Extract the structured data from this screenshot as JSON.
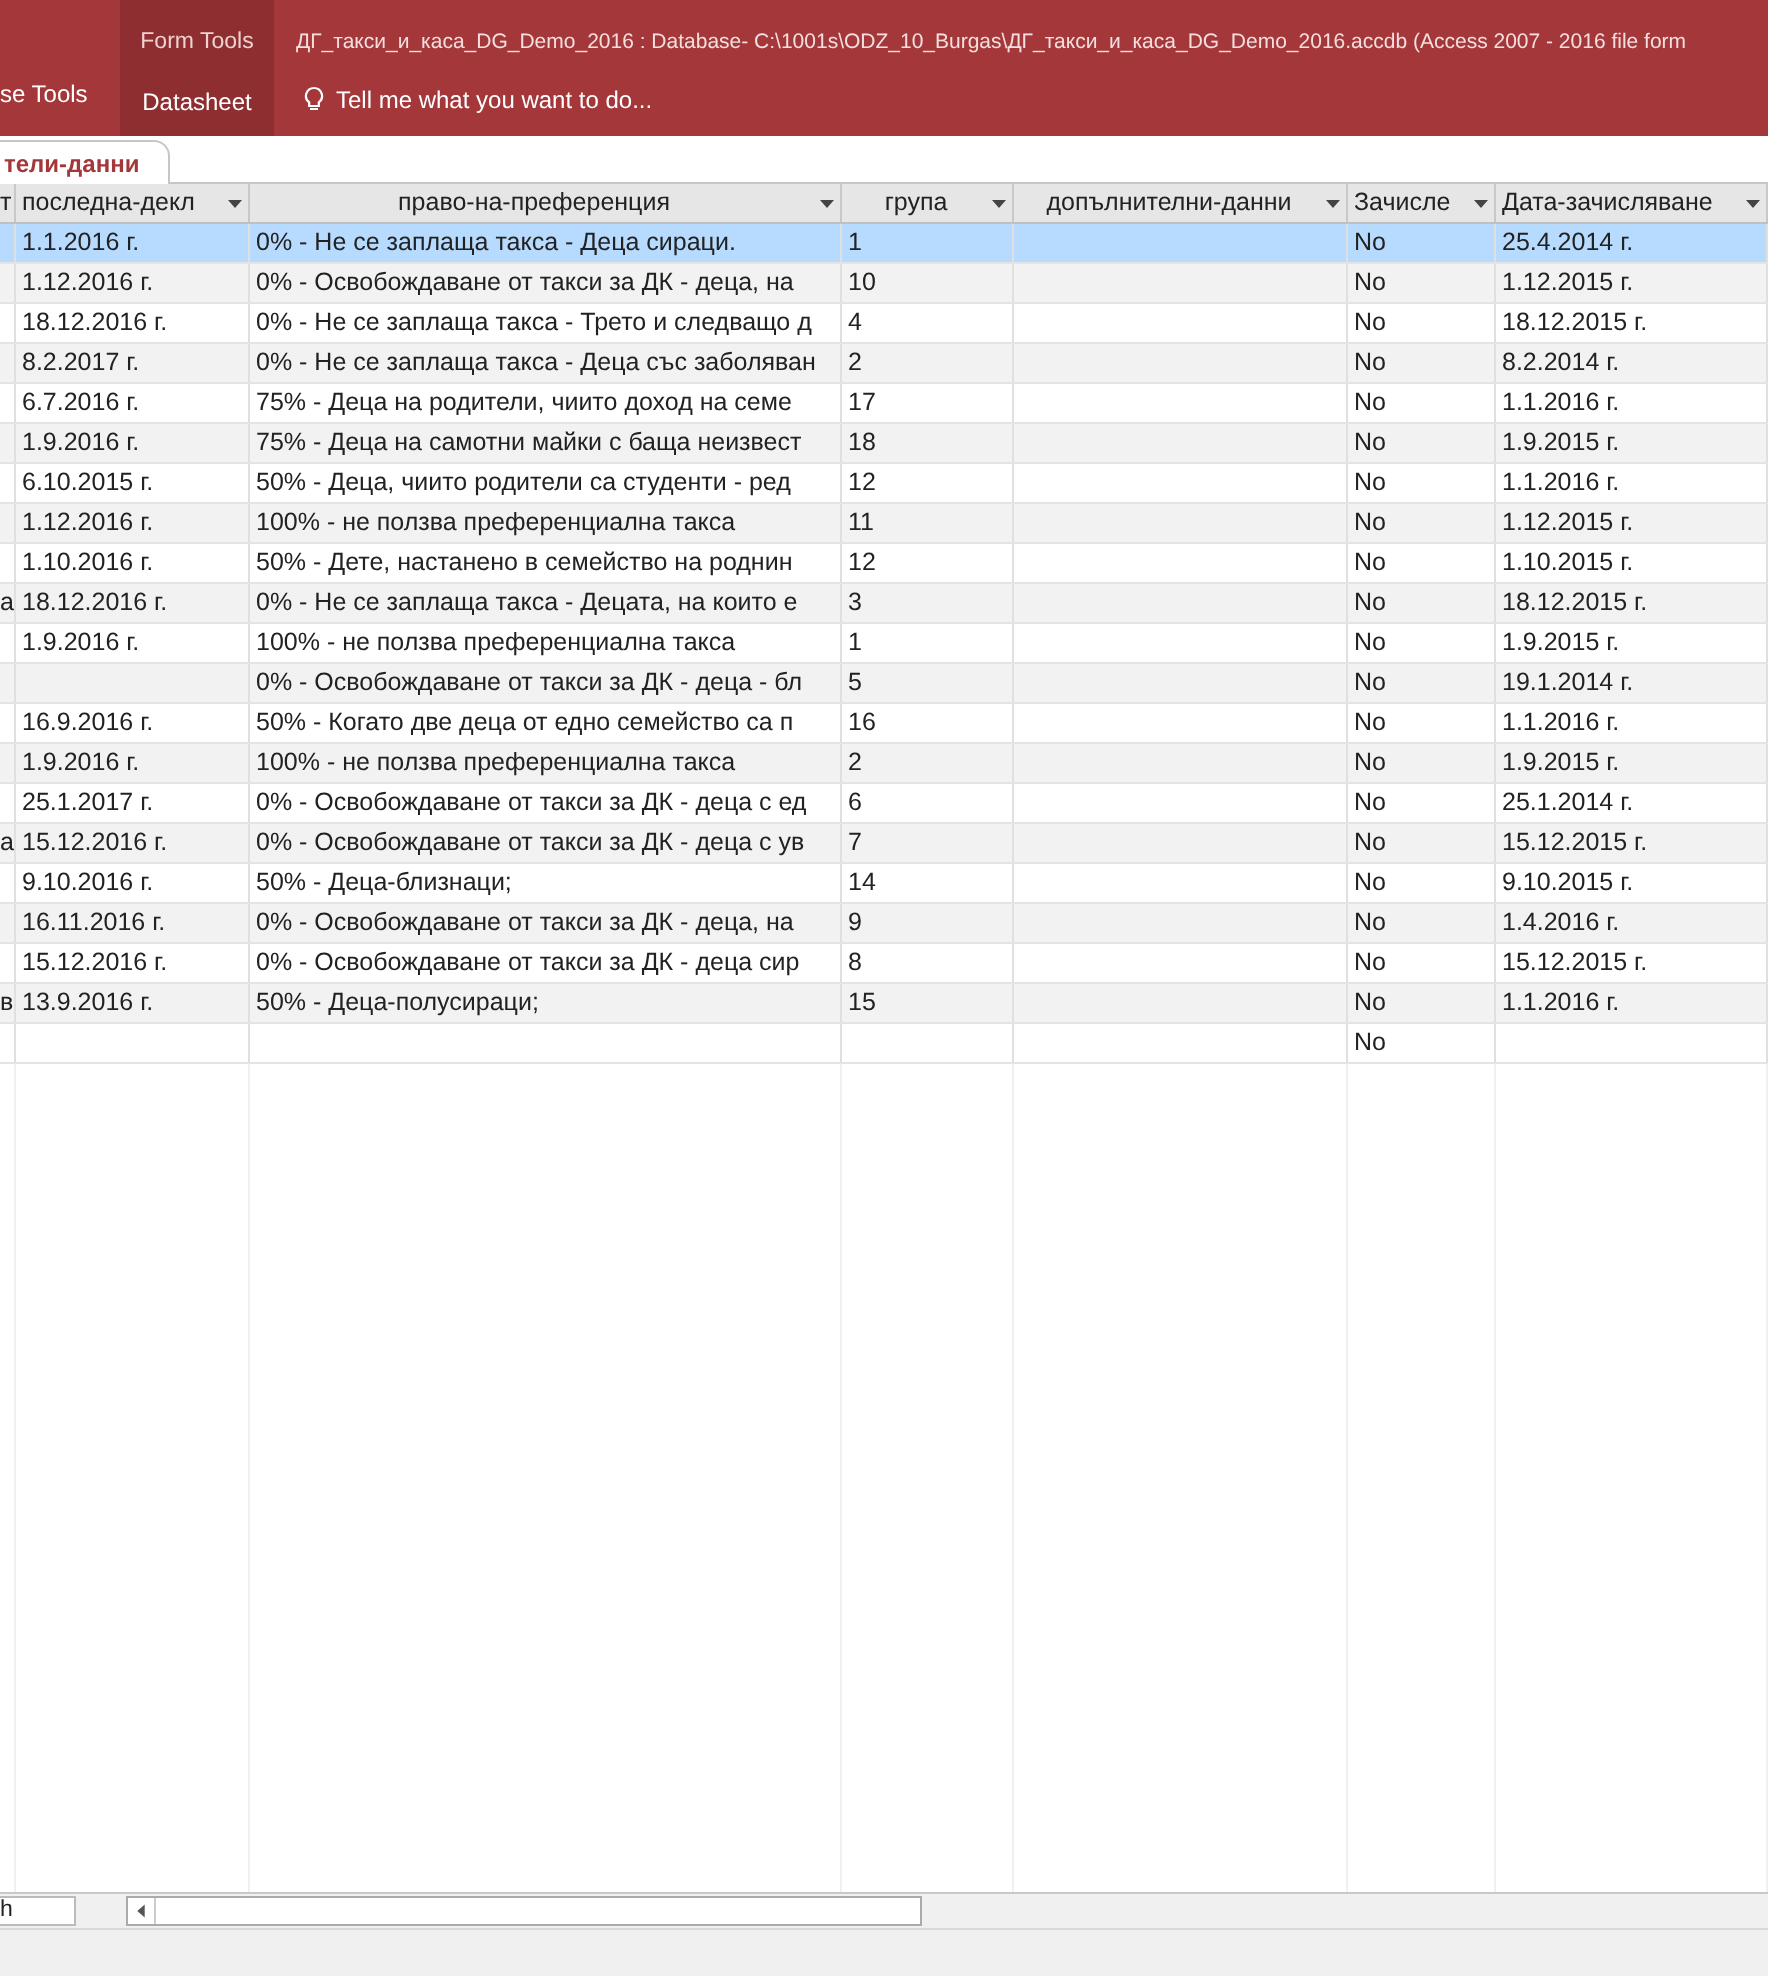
{
  "ribbon": {
    "left_tab": "se Tools",
    "context_group": "Form Tools",
    "context_tab": {
      "label": "Datasheet",
      "selected": true
    },
    "tell_me": "Tell me what you want to do...",
    "title": "ДГ_такси_и_каса_DG_Demo_2016 : Database- C:\\1001s\\ODZ_10_Burgas\\ДГ_такси_и_каса_DG_Demo_2016.accdb (Access 2007 - 2016 file form"
  },
  "document_tab": {
    "label": "тели-данни",
    "selected": true
  },
  "table": {
    "columns": [
      {
        "label": "т"
      },
      {
        "label": "последна-декл"
      },
      {
        "label": "право-на-преференция"
      },
      {
        "label": "група"
      },
      {
        "label": "допълнителни-данни"
      },
      {
        "label": "Зачисле"
      },
      {
        "label": "Дата-зачисляване"
      }
    ],
    "rows": [
      {
        "selected": true,
        "cells": [
          "",
          "1.1.2016 г.",
          "0% - Не се заплаща такса - Деца сираци.",
          "1",
          "",
          "No",
          "25.4.2014 г."
        ]
      },
      {
        "selected": false,
        "cells": [
          "",
          "1.12.2016 г.",
          "0% - Освобождаване от такси за ДК - деца, на",
          "10",
          "",
          "No",
          "1.12.2015 г."
        ]
      },
      {
        "selected": false,
        "cells": [
          "",
          "18.12.2016 г.",
          "0% - Не се заплаща такса - Трето и следващо д",
          "4",
          "",
          "No",
          "18.12.2015 г."
        ]
      },
      {
        "selected": false,
        "cells": [
          "",
          "8.2.2017 г.",
          "0% - Не се заплаща такса - Деца със заболяван",
          "2",
          "",
          "No",
          "8.2.2014 г."
        ]
      },
      {
        "selected": false,
        "cells": [
          "",
          "6.7.2016 г.",
          "75% - Деца на родители, чиито доход на семе",
          "17",
          "",
          "No",
          "1.1.2016 г."
        ]
      },
      {
        "selected": false,
        "cells": [
          "",
          "1.9.2016 г.",
          "75% - Деца на самотни майки с баща неизвест",
          "18",
          "",
          "No",
          "1.9.2015 г."
        ]
      },
      {
        "selected": false,
        "cells": [
          "",
          "6.10.2015 г.",
          "50% - Деца, чиито родители са студенти - ред",
          "12",
          "",
          "No",
          "1.1.2016 г."
        ]
      },
      {
        "selected": false,
        "cells": [
          "",
          "1.12.2016 г.",
          "100% - не ползва преференциална такса",
          "11",
          "",
          "No",
          "1.12.2015 г."
        ]
      },
      {
        "selected": false,
        "cells": [
          "",
          "1.10.2016 г.",
          "50% - Дете, настанено в семейство на роднин",
          "12",
          "",
          "No",
          "1.10.2015 г."
        ]
      },
      {
        "selected": false,
        "cells": [
          "а",
          "18.12.2016 г.",
          "0% - Не се заплаща такса - Децата, на които е",
          "3",
          "",
          "No",
          "18.12.2015 г."
        ]
      },
      {
        "selected": false,
        "cells": [
          "",
          "1.9.2016 г.",
          "100% - не ползва преференциална такса",
          "1",
          "",
          "No",
          "1.9.2015 г."
        ]
      },
      {
        "selected": false,
        "cells": [
          "",
          "",
          "0% - Освобождаване от такси за ДК - деца - бл",
          "5",
          "",
          "No",
          "19.1.2014 г."
        ]
      },
      {
        "selected": false,
        "cells": [
          "",
          "16.9.2016 г.",
          "50% - Когато две деца от едно семейство са п",
          "16",
          "",
          "No",
          "1.1.2016 г."
        ]
      },
      {
        "selected": false,
        "cells": [
          "",
          "1.9.2016 г.",
          "100% - не ползва преференциална такса",
          "2",
          "",
          "No",
          "1.9.2015 г."
        ]
      },
      {
        "selected": false,
        "cells": [
          "",
          "25.1.2017 г.",
          "0% - Освобождаване от такси за ДК - деца с ед",
          "6",
          "",
          "No",
          "25.1.2014 г."
        ]
      },
      {
        "selected": false,
        "cells": [
          "а",
          "15.12.2016 г.",
          "0% - Освобождаване от такси за ДК - деца с ув",
          "7",
          "",
          "No",
          "15.12.2015 г."
        ]
      },
      {
        "selected": false,
        "cells": [
          "",
          "9.10.2016 г.",
          "50% - Деца-близнаци;",
          "14",
          "",
          "No",
          "9.10.2015 г."
        ]
      },
      {
        "selected": false,
        "cells": [
          "",
          "16.11.2016 г.",
          "0% - Освобождаване от такси за ДК - деца, на",
          "9",
          "",
          "No",
          "1.4.2016 г."
        ]
      },
      {
        "selected": false,
        "cells": [
          "",
          "15.12.2016 г.",
          "0% - Освобождаване от такси за ДК - деца сир",
          "8",
          "",
          "No",
          "15.12.2015 г."
        ]
      },
      {
        "selected": false,
        "cells": [
          "в",
          "13.9.2016 г.",
          "50% - Деца-полусираци;",
          "15",
          "",
          "No",
          "1.1.2016 г."
        ]
      },
      {
        "selected": false,
        "cells": [
          "",
          "",
          "",
          "",
          "",
          "No",
          ""
        ]
      }
    ]
  },
  "navigation": {
    "search_value": "h"
  }
}
